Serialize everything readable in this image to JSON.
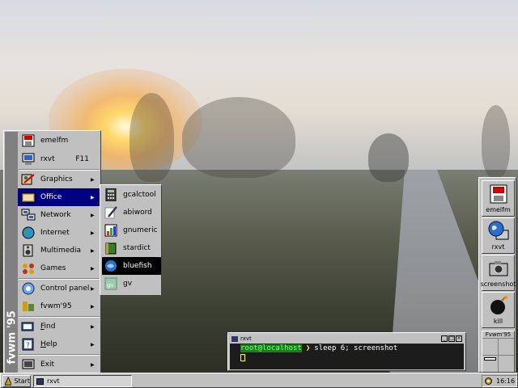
{
  "menu": {
    "side_label": "fvwm '95",
    "items": [
      {
        "label": "emelfm",
        "icon": "emelfm-icon",
        "shortcut": ""
      },
      {
        "label": "rxvt",
        "icon": "monitor-icon",
        "shortcut": "F11"
      },
      {
        "label": "Graphics",
        "icon": "graphics-icon",
        "submenu": true
      },
      {
        "label": "Office",
        "icon": "office-icon",
        "submenu": true,
        "selected": true
      },
      {
        "label": "Network",
        "icon": "network-icon",
        "submenu": true
      },
      {
        "label": "Internet",
        "icon": "globe-icon",
        "submenu": true
      },
      {
        "label": "Multimedia",
        "icon": "speaker-icon",
        "submenu": true
      },
      {
        "label": "Games",
        "icon": "games-icon",
        "submenu": true
      },
      {
        "label": "Control panel",
        "icon": "control-panel-icon",
        "submenu": true
      },
      {
        "label": "fvwm'95",
        "icon": "fvwm-icon",
        "submenu": true
      },
      {
        "label": "Find",
        "icon": "find-icon",
        "submenu": true,
        "underline": "F"
      },
      {
        "label": "Help",
        "icon": "help-icon",
        "submenu": true,
        "underline": "H"
      },
      {
        "label": "Exit",
        "icon": "exit-icon",
        "submenu": true
      }
    ]
  },
  "submenu": {
    "items": [
      {
        "label": "gcalctool",
        "icon": "calculator-icon"
      },
      {
        "label": "abiword",
        "icon": "pen-icon"
      },
      {
        "label": "gnumeric",
        "icon": "spreadsheet-icon"
      },
      {
        "label": "stardict",
        "icon": "dictionary-icon"
      },
      {
        "label": "bluefish",
        "icon": "bluefish-icon",
        "selected": true
      },
      {
        "label": "gv",
        "icon": "gv-icon"
      }
    ]
  },
  "dock": {
    "buttons": [
      {
        "label": "emelfm",
        "icon": "emelfm-icon"
      },
      {
        "label": "rxvt",
        "icon": "globe-monitor-icon"
      },
      {
        "label": "screenshot",
        "icon": "camera-icon"
      },
      {
        "label": "kill",
        "icon": "bomb-icon"
      }
    ],
    "pager_label": "Fvwm'95"
  },
  "terminal": {
    "title": "rxvt",
    "prompt": "root@localhost",
    "command": "sleep 6; screenshot"
  },
  "taskbar": {
    "start_label": "Start",
    "task_label": "rxvt",
    "clock": "16:16"
  },
  "colors": {
    "menu_bg": "#c0c0c0",
    "selection": "#000080",
    "terminal_bg": "#1c1c1c"
  }
}
